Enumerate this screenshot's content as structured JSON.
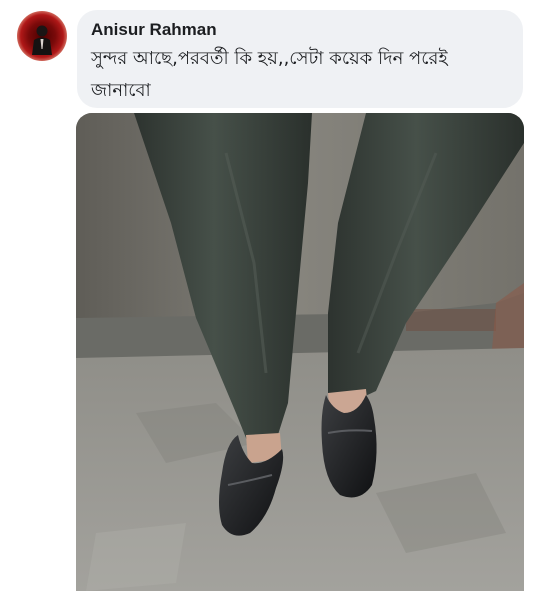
{
  "comment": {
    "author_name": "Anisur Rahman",
    "text": "সুন্দর আছে,পরবর্তী কি হয়,,সেটা কয়েক দিন পরেই জানাবো",
    "avatar_icon": "profile-avatar",
    "bubble_color": "#eff1f4"
  },
  "attachment": {
    "type": "photo",
    "subject": "legs-in-dark-trousers-and-black-loafers"
  }
}
